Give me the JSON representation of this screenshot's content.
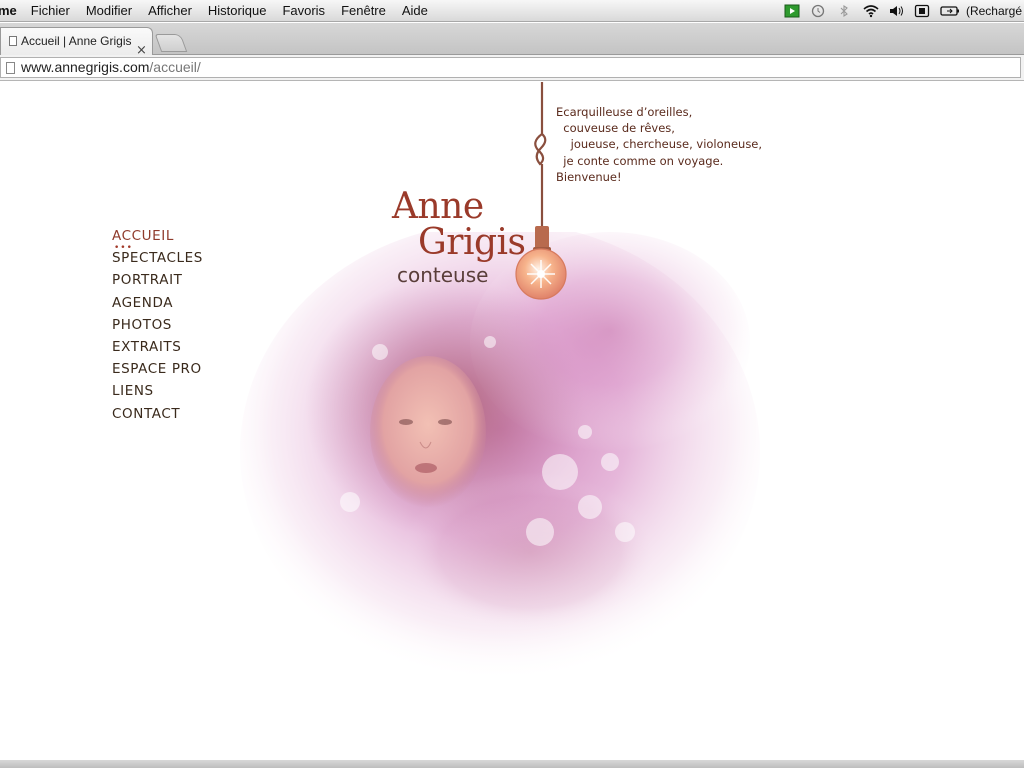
{
  "menubar": {
    "app": "me",
    "items": [
      "Fichier",
      "Modifier",
      "Afficher",
      "Historique",
      "Favoris",
      "Fenêtre",
      "Aide"
    ],
    "battery_label": "(Rechargé"
  },
  "browser": {
    "tab_title": "Accueil | Anne Grigis",
    "url_host": "www.annegrigis.com",
    "url_path": "/accueil/"
  },
  "site": {
    "name_first": "Anne",
    "name_last": "Grigis",
    "subtitle": "conteuse",
    "tagline": "Ecarquilleuse d’oreilles,\n  couveuse de rêves,\n    joueuse, chercheuse, violoneuse,\n  je conte comme on voyage.\nBienvenue!",
    "nav": [
      "ACCUEIL",
      "SPECTACLES",
      "PORTRAIT",
      "AGENDA",
      "PHOTOS",
      "EXTRAITS",
      "ESPACE PRO",
      "LIENS",
      "CONTACT"
    ],
    "active_nav": "ACCUEIL",
    "colors": {
      "accent": "#9a3a2a",
      "text": "#3a2a1c",
      "mist": "#d88ec4",
      "bulb": "#f2a27a"
    }
  }
}
